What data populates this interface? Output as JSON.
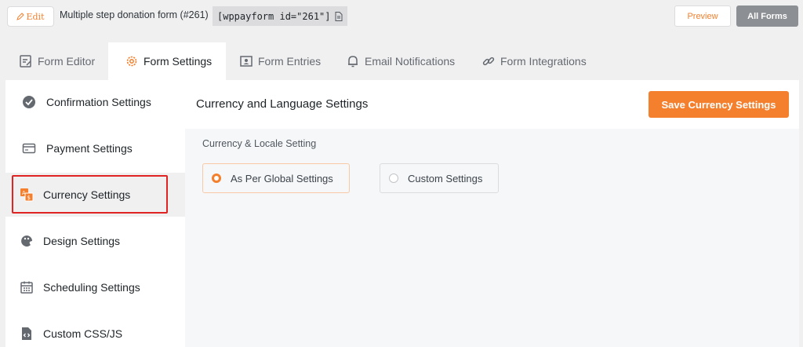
{
  "topbar": {
    "edit_label": "Edit",
    "form_title": "Multiple step donation form (#261)",
    "shortcode": "[wppayform id=\"261\"]",
    "preview_label": "Preview",
    "all_forms_label": "All Forms"
  },
  "tabs": [
    {
      "label": "Form Editor",
      "icon": "form-editor-icon",
      "active": false
    },
    {
      "label": "Form Settings",
      "icon": "gear-icon",
      "active": true
    },
    {
      "label": "Form Entries",
      "icon": "entries-icon",
      "active": false
    },
    {
      "label": "Email Notifications",
      "icon": "bell-icon",
      "active": false
    },
    {
      "label": "Form Integrations",
      "icon": "link-icon",
      "active": false
    }
  ],
  "sidebar": {
    "items": [
      {
        "label": "Confirmation Settings",
        "icon": "check-circle-icon"
      },
      {
        "label": "Payment Settings",
        "icon": "card-icon"
      },
      {
        "label": "Currency Settings",
        "icon": "currency-icon",
        "active": true
      },
      {
        "label": "Design Settings",
        "icon": "palette-icon"
      },
      {
        "label": "Scheduling Settings",
        "icon": "calendar-icon"
      },
      {
        "label": "Custom CSS/JS",
        "icon": "code-file-icon"
      }
    ]
  },
  "main": {
    "title": "Currency and Language Settings",
    "save_label": "Save Currency Settings",
    "section_label": "Currency & Locale Setting",
    "options": [
      {
        "label": "As Per Global Settings",
        "selected": true
      },
      {
        "label": "Custom Settings",
        "selected": false
      }
    ]
  },
  "colors": {
    "accent": "#f47f2d",
    "highlight": "#e02424",
    "grey_button": "#8c8f94"
  }
}
